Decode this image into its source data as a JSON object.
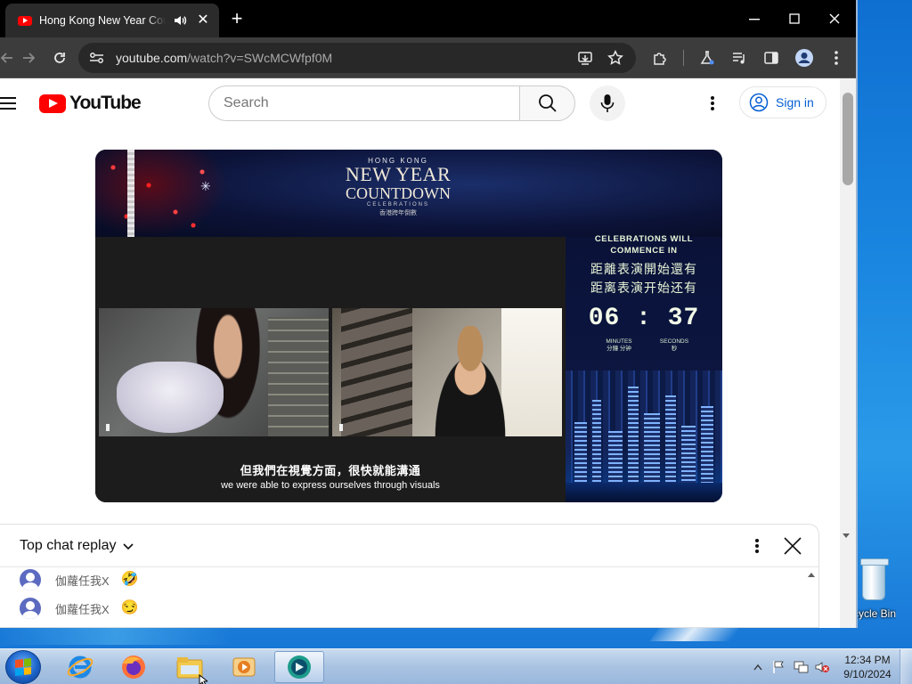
{
  "browser": {
    "tab_title": "Hong Kong New Year Countdown Celebrations",
    "url_host": "youtube.com",
    "url_path": "/watch?v=SWcMCWfpf0M"
  },
  "youtube": {
    "logo_text": "YouTube",
    "search_placeholder": "Search",
    "sign_in_label": "Sign in"
  },
  "video": {
    "title_line1": "HONG KONG",
    "title_line2": "NEW YEAR",
    "title_line3": "COUNTDOWN",
    "title_line4": "CELEBRATIONS",
    "title_zh": "香港跨年倒數",
    "celebrations_en_1": "CELEBRATIONS WILL",
    "celebrations_en_2": "COMMENCE IN",
    "celebrations_zh_trad": "距離表演開始還有",
    "celebrations_zh_simp": "距离表演开始还有",
    "countdown": "06 : 37",
    "minutes_label": "MINUTES",
    "minutes_zh": "分鐘 分钟",
    "seconds_label": "SECONDS",
    "seconds_zh": "秒",
    "subtitle_zh": "但我們在視覺方面，很快就能溝通",
    "subtitle_en": "we were able to express ourselves through visuals"
  },
  "chat": {
    "title": "Top chat replay",
    "messages": [
      {
        "author": "伽蘿任我X",
        "emoji": "🤣"
      },
      {
        "author": "伽蘿任我X",
        "emoji": "😏"
      }
    ]
  },
  "desktop": {
    "recycle_bin_label": "Recycle Bin"
  },
  "taskbar": {
    "apps": [
      "internet-explorer",
      "firefox",
      "file-explorer",
      "media-player",
      "chrome"
    ],
    "active_app": "chrome",
    "time": "12:34 PM",
    "date": "9/10/2024"
  }
}
